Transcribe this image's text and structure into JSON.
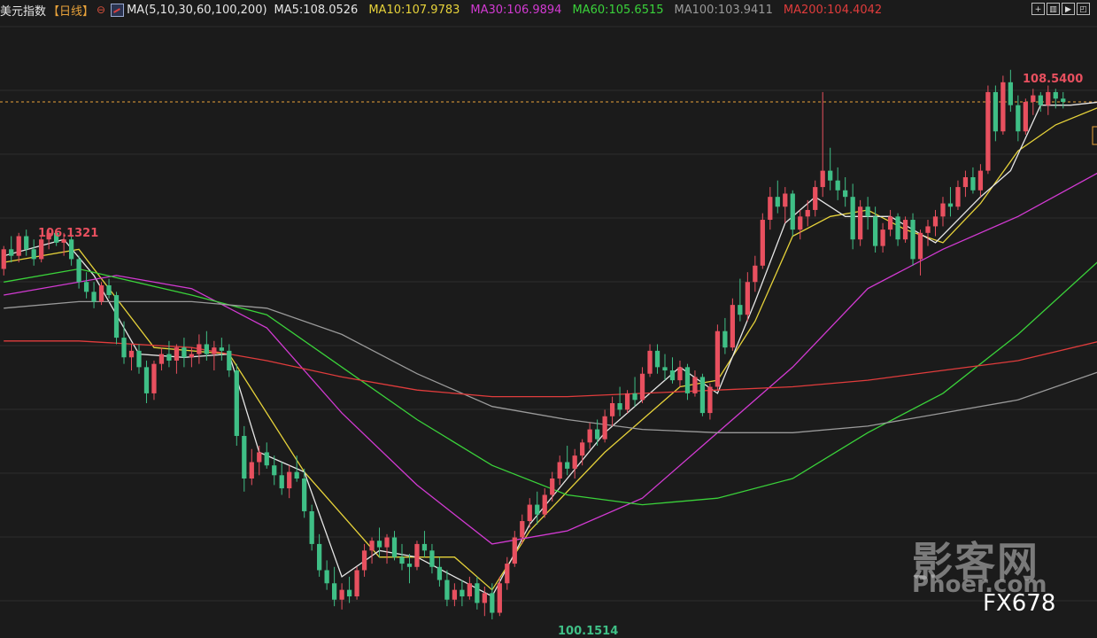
{
  "header": {
    "instrument": "美元指数",
    "period": "【日线】",
    "settings_icon": "settings-gear-icon",
    "ma_icon": "ma-chart-icon",
    "ma_definition": "MA(5,10,30,60,100,200)",
    "ma_values": [
      {
        "label": "MA5:108.0526",
        "color": "#e6e6e6"
      },
      {
        "label": "MA10:107.9783",
        "color": "#e6d23a"
      },
      {
        "label": "MA30:106.9894",
        "color": "#d23ad2"
      },
      {
        "label": "MA60:105.6515",
        "color": "#3ad23a"
      },
      {
        "label": "MA100:103.9411",
        "color": "#9a9a9a"
      },
      {
        "label": "MA200:104.4042",
        "color": "#e03c3c"
      }
    ],
    "toolbar_icons": [
      "zoom-icon",
      "layout-icon",
      "play-icon",
      "fullscreen-icon"
    ]
  },
  "annotations": {
    "high_left": "106.1321",
    "high_right": "108.5400",
    "low": "100.1514"
  },
  "watermark": {
    "brand_cn": "影客网",
    "brand_en": "Phoer.com",
    "tag": "FX678"
  },
  "colors": {
    "up": "#e8505f",
    "down": "#3fbf86",
    "background": "#1b1b1b",
    "grid": "#2c2c2c",
    "price_line": "#e8a23a"
  },
  "chart_data": {
    "type": "candlestick",
    "ylim": [
      100.0,
      109.2
    ],
    "current_price_line": 108.05,
    "candles": [
      [
        105.5,
        105.85,
        105.4,
        105.8
      ],
      [
        105.8,
        106.0,
        105.6,
        105.7
      ],
      [
        105.7,
        106.05,
        105.6,
        106.0
      ],
      [
        106.0,
        106.1,
        105.7,
        105.8
      ],
      [
        105.8,
        105.95,
        105.55,
        105.65
      ],
      [
        105.65,
        106.0,
        105.6,
        105.95
      ],
      [
        105.95,
        106.13,
        105.8,
        106.05
      ],
      [
        106.05,
        106.1,
        105.85,
        105.9
      ],
      [
        105.9,
        106.05,
        105.7,
        105.95
      ],
      [
        105.95,
        106.05,
        105.55,
        105.65
      ],
      [
        105.65,
        105.7,
        105.2,
        105.3
      ],
      [
        105.3,
        105.45,
        105.05,
        105.15
      ],
      [
        105.15,
        105.3,
        104.9,
        105.0
      ],
      [
        105.0,
        105.3,
        104.95,
        105.25
      ],
      [
        105.25,
        105.35,
        105.05,
        105.1
      ],
      [
        105.1,
        105.15,
        104.35,
        104.45
      ],
      [
        104.45,
        104.7,
        104.05,
        104.15
      ],
      [
        104.15,
        104.35,
        103.95,
        104.25
      ],
      [
        104.25,
        104.35,
        103.9,
        104.0
      ],
      [
        104.0,
        104.1,
        103.45,
        103.6
      ],
      [
        103.6,
        104.1,
        103.5,
        104.05
      ],
      [
        104.05,
        104.3,
        103.95,
        104.2
      ],
      [
        104.2,
        104.4,
        104.0,
        104.1
      ],
      [
        104.1,
        104.35,
        103.9,
        104.3
      ],
      [
        104.3,
        104.45,
        104.0,
        104.15
      ],
      [
        104.15,
        104.3,
        104.0,
        104.2
      ],
      [
        104.2,
        104.5,
        104.05,
        104.35
      ],
      [
        104.35,
        104.55,
        104.1,
        104.2
      ],
      [
        104.2,
        104.4,
        103.95,
        104.3
      ],
      [
        104.3,
        104.45,
        104.1,
        104.25
      ],
      [
        104.25,
        104.35,
        103.85,
        103.95
      ],
      [
        103.95,
        104.05,
        102.8,
        102.95
      ],
      [
        102.95,
        103.1,
        102.1,
        102.3
      ],
      [
        102.3,
        102.75,
        102.2,
        102.55
      ],
      [
        102.55,
        102.8,
        102.35,
        102.7
      ],
      [
        102.7,
        102.85,
        102.45,
        102.5
      ],
      [
        102.5,
        102.65,
        102.2,
        102.35
      ],
      [
        102.35,
        102.55,
        102.05,
        102.15
      ],
      [
        102.15,
        102.5,
        102.0,
        102.4
      ],
      [
        102.4,
        102.65,
        102.25,
        102.3
      ],
      [
        102.3,
        102.45,
        101.7,
        101.8
      ],
      [
        101.8,
        101.9,
        101.2,
        101.3
      ],
      [
        101.3,
        101.45,
        100.8,
        100.9
      ],
      [
        100.9,
        101.05,
        100.6,
        100.7
      ],
      [
        100.7,
        100.95,
        100.35,
        100.45
      ],
      [
        100.45,
        100.7,
        100.3,
        100.6
      ],
      [
        100.6,
        100.8,
        100.4,
        100.5
      ],
      [
        100.5,
        100.95,
        100.45,
        100.9
      ],
      [
        100.9,
        101.3,
        100.8,
        101.2
      ],
      [
        101.2,
        101.4,
        101.0,
        101.35
      ],
      [
        101.35,
        101.55,
        101.1,
        101.25
      ],
      [
        101.25,
        101.45,
        101.0,
        101.4
      ],
      [
        101.4,
        101.5,
        101.05,
        101.1
      ],
      [
        101.1,
        101.3,
        100.9,
        101.0
      ],
      [
        101.0,
        101.15,
        100.7,
        100.95
      ],
      [
        100.95,
        101.35,
        100.9,
        101.3
      ],
      [
        101.3,
        101.5,
        101.1,
        101.2
      ],
      [
        101.2,
        101.3,
        100.85,
        100.95
      ],
      [
        100.95,
        101.1,
        100.65,
        100.75
      ],
      [
        100.75,
        100.9,
        100.35,
        100.45
      ],
      [
        100.45,
        100.7,
        100.35,
        100.6
      ],
      [
        100.6,
        100.75,
        100.35,
        100.5
      ],
      [
        100.5,
        100.8,
        100.45,
        100.7
      ],
      [
        100.7,
        100.8,
        100.3,
        100.4
      ],
      [
        100.4,
        100.65,
        100.2,
        100.55
      ],
      [
        100.55,
        100.7,
        100.15,
        100.25
      ],
      [
        100.25,
        100.8,
        100.2,
        100.7
      ],
      [
        100.7,
        101.1,
        100.6,
        101.0
      ],
      [
        101.0,
        101.5,
        100.95,
        101.4
      ],
      [
        101.4,
        101.75,
        101.3,
        101.65
      ],
      [
        101.65,
        102.0,
        101.55,
        101.9
      ],
      [
        101.9,
        102.1,
        101.6,
        101.75
      ],
      [
        101.75,
        102.15,
        101.7,
        102.05
      ],
      [
        102.05,
        102.4,
        101.95,
        102.3
      ],
      [
        102.3,
        102.65,
        102.2,
        102.55
      ],
      [
        102.55,
        102.8,
        102.35,
        102.45
      ],
      [
        102.45,
        102.75,
        102.3,
        102.65
      ],
      [
        102.65,
        102.9,
        102.5,
        102.85
      ],
      [
        102.85,
        103.15,
        102.75,
        103.05
      ],
      [
        103.05,
        103.2,
        102.8,
        102.9
      ],
      [
        102.9,
        103.35,
        102.85,
        103.25
      ],
      [
        103.25,
        103.55,
        103.1,
        103.45
      ],
      [
        103.45,
        103.7,
        103.25,
        103.35
      ],
      [
        103.35,
        103.65,
        103.3,
        103.6
      ],
      [
        103.6,
        103.85,
        103.4,
        103.5
      ],
      [
        103.5,
        104.0,
        103.45,
        103.9
      ],
      [
        103.9,
        104.35,
        103.85,
        104.25
      ],
      [
        104.25,
        104.35,
        103.9,
        104.0
      ],
      [
        104.0,
        104.2,
        103.8,
        103.95
      ],
      [
        103.95,
        104.15,
        103.75,
        103.8
      ],
      [
        103.8,
        104.1,
        103.7,
        104.0
      ],
      [
        104.0,
        104.05,
        103.5,
        103.6
      ],
      [
        103.6,
        103.95,
        103.55,
        103.85
      ],
      [
        103.85,
        103.9,
        103.25,
        103.3
      ],
      [
        103.3,
        103.75,
        103.2,
        103.7
      ],
      [
        103.7,
        104.65,
        103.65,
        104.55
      ],
      [
        104.55,
        104.75,
        104.2,
        104.3
      ],
      [
        104.3,
        105.05,
        104.25,
        104.95
      ],
      [
        104.95,
        105.35,
        104.7,
        104.8
      ],
      [
        104.8,
        105.45,
        104.7,
        105.3
      ],
      [
        105.3,
        105.7,
        105.15,
        105.55
      ],
      [
        105.55,
        106.35,
        105.5,
        106.25
      ],
      [
        106.25,
        106.75,
        106.1,
        106.6
      ],
      [
        106.6,
        106.85,
        106.35,
        106.45
      ],
      [
        106.45,
        106.75,
        106.2,
        106.65
      ],
      [
        106.65,
        106.7,
        106.0,
        106.1
      ],
      [
        106.1,
        106.4,
        105.95,
        106.3
      ],
      [
        106.3,
        106.55,
        106.15,
        106.4
      ],
      [
        106.4,
        106.85,
        106.3,
        106.75
      ],
      [
        106.75,
        108.2,
        106.6,
        107.0
      ],
      [
        107.0,
        107.35,
        106.7,
        106.85
      ],
      [
        106.85,
        107.05,
        106.55,
        106.7
      ],
      [
        106.7,
        106.9,
        106.45,
        106.6
      ],
      [
        106.6,
        106.8,
        105.8,
        105.95
      ],
      [
        105.95,
        106.55,
        105.85,
        106.45
      ],
      [
        106.45,
        106.6,
        106.1,
        106.3
      ],
      [
        106.3,
        106.45,
        105.75,
        105.85
      ],
      [
        105.85,
        106.2,
        105.75,
        106.1
      ],
      [
        106.1,
        106.4,
        106.0,
        106.3
      ],
      [
        106.3,
        106.35,
        105.85,
        105.95
      ],
      [
        105.95,
        106.3,
        105.9,
        106.25
      ],
      [
        106.25,
        106.35,
        105.55,
        105.65
      ],
      [
        105.65,
        106.1,
        105.4,
        106.05
      ],
      [
        106.05,
        106.25,
        105.85,
        106.15
      ],
      [
        106.15,
        106.4,
        106.0,
        106.3
      ],
      [
        106.3,
        106.6,
        106.15,
        106.5
      ],
      [
        106.5,
        106.75,
        106.3,
        106.45
      ],
      [
        106.45,
        106.85,
        106.4,
        106.75
      ],
      [
        106.75,
        107.0,
        106.6,
        106.9
      ],
      [
        106.9,
        107.05,
        106.65,
        106.7
      ],
      [
        106.7,
        107.1,
        106.6,
        107.0
      ],
      [
        107.0,
        108.3,
        106.95,
        108.2
      ],
      [
        108.2,
        108.3,
        107.45,
        107.6
      ],
      [
        107.6,
        108.45,
        107.55,
        108.35
      ],
      [
        108.35,
        108.54,
        107.9,
        108.0
      ],
      [
        108.0,
        108.15,
        107.45,
        107.6
      ],
      [
        107.6,
        108.1,
        107.55,
        108.05
      ],
      [
        108.05,
        108.25,
        107.85,
        108.15
      ],
      [
        108.15,
        108.2,
        107.9,
        108.0
      ],
      [
        108.0,
        108.3,
        107.85,
        108.2
      ],
      [
        108.2,
        108.25,
        107.95,
        108.1
      ],
      [
        108.1,
        108.2,
        107.95,
        108.05
      ]
    ],
    "ma_lines": [
      {
        "name": "MA10",
        "color": "#e6d23a",
        "points": [
          [
            0,
            105.6
          ],
          [
            10,
            105.8
          ],
          [
            20,
            104.3
          ],
          [
            30,
            104.2
          ],
          [
            40,
            102.4
          ],
          [
            50,
            101.1
          ],
          [
            60,
            101.1
          ],
          [
            65,
            100.6
          ],
          [
            70,
            101.5
          ],
          [
            80,
            102.7
          ],
          [
            90,
            103.7
          ],
          [
            95,
            103.8
          ],
          [
            100,
            104.7
          ],
          [
            105,
            106.0
          ],
          [
            110,
            106.3
          ],
          [
            115,
            106.4
          ],
          [
            120,
            106.1
          ],
          [
            125,
            105.9
          ],
          [
            130,
            106.5
          ],
          [
            135,
            107.3
          ],
          [
            140,
            107.7
          ],
          [
            146,
            107.98
          ]
        ]
      },
      {
        "name": "MA5",
        "color": "#e6e6e6",
        "points": [
          [
            0,
            105.7
          ],
          [
            8,
            105.95
          ],
          [
            12,
            105.4
          ],
          [
            18,
            104.2
          ],
          [
            24,
            104.15
          ],
          [
            30,
            104.2
          ],
          [
            34,
            102.7
          ],
          [
            40,
            102.4
          ],
          [
            45,
            100.8
          ],
          [
            50,
            101.2
          ],
          [
            55,
            101.1
          ],
          [
            60,
            100.8
          ],
          [
            65,
            100.5
          ],
          [
            70,
            101.6
          ],
          [
            75,
            102.3
          ],
          [
            80,
            103.0
          ],
          [
            85,
            103.5
          ],
          [
            90,
            104.0
          ],
          [
            95,
            103.6
          ],
          [
            100,
            105.0
          ],
          [
            104,
            106.2
          ],
          [
            108,
            106.6
          ],
          [
            112,
            106.3
          ],
          [
            118,
            106.3
          ],
          [
            124,
            105.9
          ],
          [
            130,
            106.6
          ],
          [
            134,
            107.0
          ],
          [
            138,
            108.0
          ],
          [
            142,
            108.0
          ],
          [
            146,
            108.05
          ]
        ]
      },
      {
        "name": "MA30",
        "color": "#d23ad2",
        "points": [
          [
            0,
            105.1
          ],
          [
            15,
            105.4
          ],
          [
            25,
            105.2
          ],
          [
            35,
            104.6
          ],
          [
            45,
            103.3
          ],
          [
            55,
            102.2
          ],
          [
            65,
            101.3
          ],
          [
            75,
            101.5
          ],
          [
            85,
            102.0
          ],
          [
            95,
            103.0
          ],
          [
            105,
            104.0
          ],
          [
            115,
            105.2
          ],
          [
            125,
            105.8
          ],
          [
            135,
            106.3
          ],
          [
            146,
            106.99
          ]
        ]
      },
      {
        "name": "MA60",
        "color": "#3ad23a",
        "points": [
          [
            0,
            105.3
          ],
          [
            10,
            105.5
          ],
          [
            25,
            105.1
          ],
          [
            35,
            104.8
          ],
          [
            45,
            104.0
          ],
          [
            55,
            103.2
          ],
          [
            65,
            102.5
          ],
          [
            75,
            102.05
          ],
          [
            85,
            101.9
          ],
          [
            95,
            102.0
          ],
          [
            105,
            102.3
          ],
          [
            115,
            103.0
          ],
          [
            125,
            103.6
          ],
          [
            135,
            104.5
          ],
          [
            146,
            105.65
          ]
        ]
      },
      {
        "name": "MA100",
        "color": "#9a9a9a",
        "points": [
          [
            0,
            104.9
          ],
          [
            10,
            105.0
          ],
          [
            25,
            105.0
          ],
          [
            35,
            104.9
          ],
          [
            45,
            104.5
          ],
          [
            55,
            103.9
          ],
          [
            65,
            103.4
          ],
          [
            75,
            103.2
          ],
          [
            85,
            103.05
          ],
          [
            95,
            103.0
          ],
          [
            105,
            103.0
          ],
          [
            115,
            103.1
          ],
          [
            125,
            103.3
          ],
          [
            135,
            103.5
          ],
          [
            146,
            103.94
          ]
        ]
      },
      {
        "name": "MA200",
        "color": "#e03c3c",
        "points": [
          [
            0,
            104.4
          ],
          [
            10,
            104.4
          ],
          [
            25,
            104.3
          ],
          [
            35,
            104.1
          ],
          [
            45,
            103.85
          ],
          [
            55,
            103.65
          ],
          [
            65,
            103.55
          ],
          [
            75,
            103.55
          ],
          [
            85,
            103.6
          ],
          [
            95,
            103.65
          ],
          [
            105,
            103.7
          ],
          [
            115,
            103.8
          ],
          [
            125,
            103.95
          ],
          [
            135,
            104.1
          ],
          [
            146,
            104.4
          ]
        ]
      }
    ]
  }
}
